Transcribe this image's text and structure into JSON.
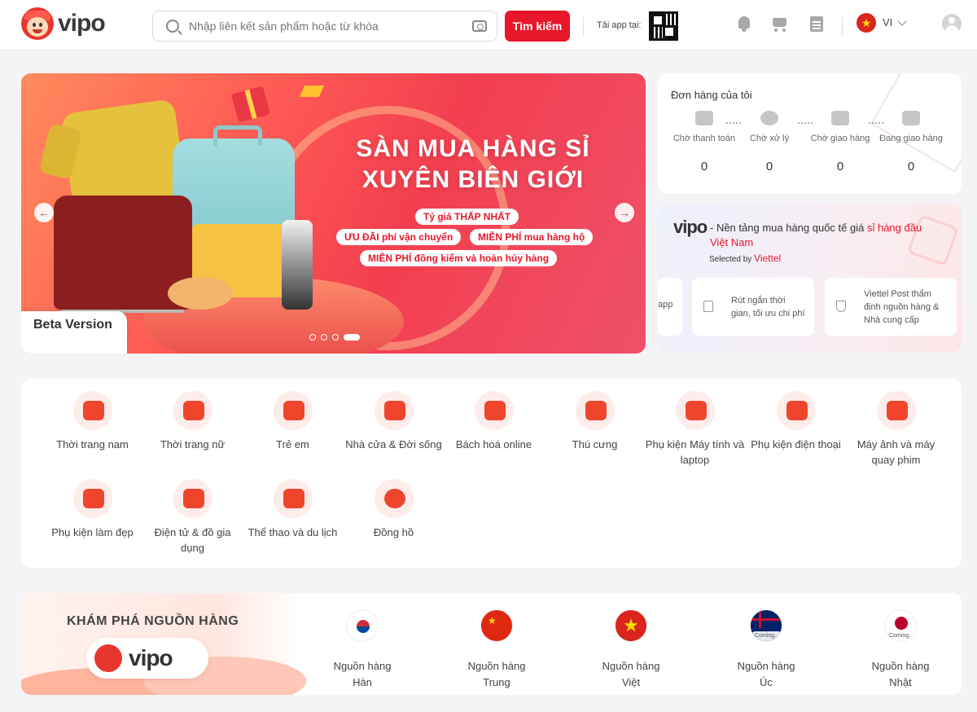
{
  "header": {
    "logo_text": "vipo",
    "search_placeholder": "Nhập liên kết sản phẩm hoặc từ khóa",
    "search_button": "Tìm kiếm",
    "app_download_label": "Tải app tại:",
    "language": "VI"
  },
  "banner": {
    "title_line1": "SÀN MUA HÀNG SỈ",
    "title_line2": "XUYÊN BIÊN GIỚI",
    "pills": [
      "Tỷ giá THẤP NHẤT",
      "ƯU ĐÃI phí vận chuyển",
      "MIỄN PHÍ mua hàng hộ",
      "MIỄN PHÍ đồng kiểm và hoàn hủy hàng"
    ],
    "beta_label": "Beta Version",
    "slide_count": 4,
    "active_slide": 4
  },
  "orders": {
    "title": "Đơn hàng của tôi",
    "statuses": [
      {
        "label": "Chờ thanh toán",
        "count": "0",
        "icon": "truck-icon"
      },
      {
        "label": "Chờ xử lý",
        "count": "0",
        "icon": "clock-icon"
      },
      {
        "label": "Chờ giao hàng",
        "count": "0",
        "icon": "package-icon"
      },
      {
        "label": "Đang giao hàng",
        "count": "0",
        "icon": "delivery-truck-icon"
      }
    ]
  },
  "promo": {
    "logo": "vipo",
    "text_prefix": "- Nền tảng mua hàng quốc tế giá ",
    "text_highlight": "sỉ hàng đầu Việt Nam",
    "selected_by": "Selected by ",
    "selected_brand": "Viettel",
    "features": [
      "app",
      "Rút ngắn thời gian, tối ưu chi phí",
      "Viettel Post thẩm định nguồn hàng & Nhà cung cấp"
    ]
  },
  "categories": [
    {
      "label": "Thời trang nam",
      "icon": "men-fashion-icon"
    },
    {
      "label": "Thời trang nữ",
      "icon": "women-fashion-icon"
    },
    {
      "label": "Trẻ em",
      "icon": "teddy-bear-icon"
    },
    {
      "label": "Nhà cửa & Đời sống",
      "icon": "sofa-lamp-icon"
    },
    {
      "label": "Bách hoá online",
      "icon": "grocery-basket-icon"
    },
    {
      "label": "Thú cưng",
      "icon": "pet-bottle-icon"
    },
    {
      "label": "Phụ kiện Máy tính và laptop",
      "icon": "keyboard-icon"
    },
    {
      "label": "Phụ kiện điện thoại",
      "icon": "phone-accessory-icon"
    },
    {
      "label": "Máy ảnh và máy quay phim",
      "icon": "camera-icon"
    },
    {
      "label": "Phụ kiện làm đẹp",
      "icon": "necklace-icon"
    },
    {
      "label": "Điện tử & đồ gia dụng",
      "icon": "fan-appliance-icon"
    },
    {
      "label": "Thể thao và du lịch",
      "icon": "luggage-shoe-icon"
    },
    {
      "label": "Đồng hồ",
      "icon": "watch-icon"
    }
  ],
  "sources": {
    "title": "KHÁM PHÁ NGUỒN HÀNG",
    "logo": "vipo",
    "items": [
      {
        "label_line1": "Nguồn hàng",
        "label_line2": "Hàn",
        "flag": "korea-flag-icon"
      },
      {
        "label_line1": "Nguồn hàng",
        "label_line2": "Trung",
        "flag": "china-flag-icon"
      },
      {
        "label_line1": "Nguồn hàng",
        "label_line2": "Việt",
        "flag": "vietnam-flag-icon"
      },
      {
        "label_line1": "Nguồn hàng",
        "label_line2": "Úc",
        "flag": "australia-flag-icon",
        "badge": "Coming..."
      },
      {
        "label_line1": "Nguồn hàng",
        "label_line2": "Nhật",
        "flag": "japan-flag-icon",
        "badge": "Coming..."
      }
    ]
  },
  "colors": {
    "brand_red": "#e8172b",
    "background": "#f4f4f6"
  }
}
